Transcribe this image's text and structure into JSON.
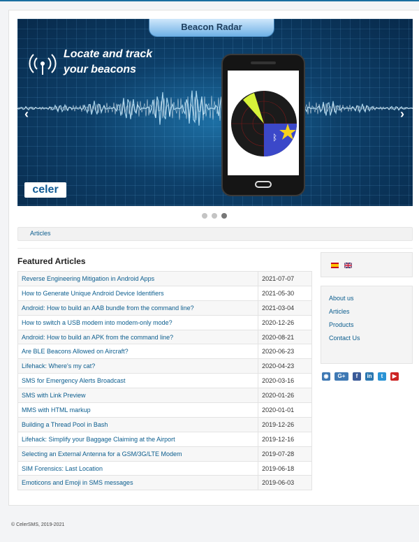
{
  "banner": {
    "tab_title": "Beacon Radar",
    "headline_line1": "Locate and track",
    "headline_line2": "your beacons",
    "logo_text": "celer",
    "prev_arrow": "‹",
    "next_arrow": "›",
    "slide_count": 3,
    "active_slide": 3
  },
  "breadcrumb": {
    "item": "Articles"
  },
  "featured": {
    "heading": "Featured Articles",
    "rows": [
      {
        "title": "Reverse Engineering Mitigation in Android Apps",
        "date": "2021-07-07"
      },
      {
        "title": "How to Generate Unique Android Device Identifiers",
        "date": "2021-05-30"
      },
      {
        "title": "Android: How to build an AAB bundle from the command line?",
        "date": "2021-03-04"
      },
      {
        "title": "How to switch a USB modem into modem-only mode?",
        "date": "2020-12-26"
      },
      {
        "title": "Android: How to build an APK from the command line?",
        "date": "2020-08-21"
      },
      {
        "title": "Are BLE Beacons Allowed on Aircraft?",
        "date": "2020-06-23"
      },
      {
        "title": "Lifehack: Where's my cat?",
        "date": "2020-04-23"
      },
      {
        "title": "SMS for Emergency Alerts Broadcast",
        "date": "2020-03-16"
      },
      {
        "title": "SMS with Link Preview",
        "date": "2020-01-26"
      },
      {
        "title": "MMS with HTML markup",
        "date": "2020-01-01"
      },
      {
        "title": "Building a Thread Pool in Bash",
        "date": "2019-12-26"
      },
      {
        "title": "Lifehack: Simplify your Baggage Claiming at the Airport",
        "date": "2019-12-16"
      },
      {
        "title": "Selecting an External Antenna for a GSM/3G/LTE Modem",
        "date": "2019-07-28"
      },
      {
        "title": "SIM Forensics: Last Location",
        "date": "2019-06-18"
      },
      {
        "title": "Emoticons and Emoji in SMS messages",
        "date": "2019-06-03"
      }
    ]
  },
  "languages": [
    {
      "icon": "spain-flag-icon"
    },
    {
      "icon": "uk-flag-icon"
    }
  ],
  "menu": {
    "items": [
      "About us",
      "Articles",
      "Products",
      "Contact Us"
    ]
  },
  "social": {
    "icons": [
      "rss-icon",
      "google-plus-icon",
      "facebook-icon",
      "linkedin-icon",
      "twitter-icon",
      "youtube-icon"
    ],
    "glyphs": {
      "rss": "◉",
      "gplus": "G+",
      "fb": "f",
      "in": "in",
      "tw": "t",
      "yt": "▶"
    }
  },
  "footer": {
    "copyright": "© CelerSMS, 2019-2021"
  },
  "colors": {
    "link": "#0b5d8e",
    "banner_bg": "#0d3f69",
    "tab": "#6fb1e6"
  }
}
